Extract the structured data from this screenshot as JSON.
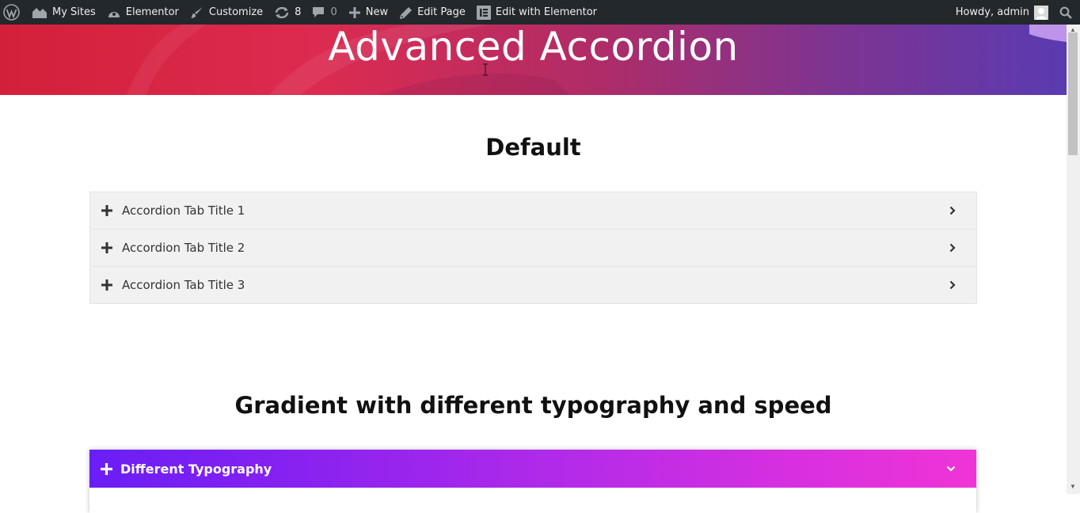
{
  "adminbar": {
    "my_sites": "My Sites",
    "elementor": "Elementor",
    "customize": "Customize",
    "updates_count": "8",
    "comments_count": "0",
    "new": "New",
    "edit_page": "Edit Page",
    "edit_with_elementor": "Edit with Elementor",
    "greeting": "Howdy, admin"
  },
  "hero": {
    "title": "Advanced Accordion"
  },
  "sections": {
    "default_heading": "Default",
    "gradient_heading": "Gradient with different typography and speed"
  },
  "default_accordion": {
    "items": [
      {
        "label": "Accordion Tab Title 1"
      },
      {
        "label": "Accordion Tab Title 2"
      },
      {
        "label": "Accordion Tab Title 3"
      }
    ]
  },
  "gradient_accordion": {
    "items": [
      {
        "label": "Different Typography"
      }
    ],
    "gradient_start": "#6a1ef5",
    "gradient_end": "#f034d6"
  },
  "colors": {
    "adminbar_bg": "#23282d",
    "hero_start": "#d3203a",
    "hero_end": "#5a3bb0",
    "accordion_bg": "#f1f1f2"
  },
  "icons": [
    "wordpress-logo-icon",
    "my-sites-icon",
    "elementor-icon",
    "brush-icon",
    "updates-icon",
    "comments-icon",
    "plus-icon",
    "pencil-icon",
    "elementor-edit-icon",
    "search-icon",
    "chevron-right-icon",
    "chevron-down-icon"
  ]
}
